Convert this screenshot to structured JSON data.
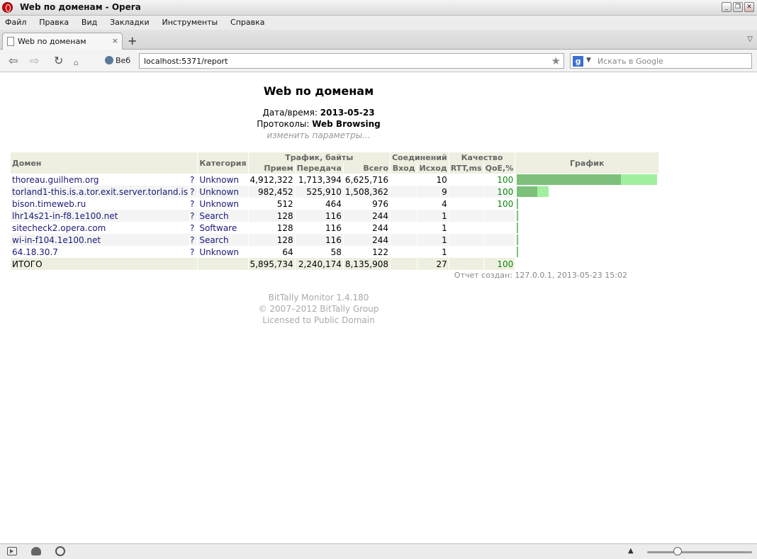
{
  "window": {
    "title": "Web по доменам - Opera"
  },
  "menu": [
    "Файл",
    "Правка",
    "Вид",
    "Закладки",
    "Инструменты",
    "Справка"
  ],
  "tab": {
    "title": "Web по доменам",
    "close": "×"
  },
  "nav": {
    "web_label": "Веб",
    "url": "localhost:5371/report",
    "search_placeholder": "Искать в Google"
  },
  "report": {
    "title": "Web по доменам",
    "datetime_label": "Дата/время:",
    "datetime_value": "2013-05-23",
    "protocols_label": "Протоколы:",
    "protocols_value": "Web Browsing",
    "change_link": "изменить параметры...",
    "headers": {
      "domain": "Домен",
      "category": "Категория",
      "traffic": "Трафик, байты",
      "connections": "Соединений",
      "quality": "Качество",
      "graph": "График",
      "recv": "Прием",
      "send": "Передача",
      "total": "Всего",
      "inbound": "Вход",
      "outbound": "Исход",
      "rtt": "RTT,ms",
      "qoe": "QoE,%"
    },
    "rows": [
      {
        "domain": "thoreau.guilhem.org",
        "q": "?",
        "category": "Unknown",
        "recv": "4,912,322",
        "send": "1,713,394",
        "total": "6,625,716",
        "in": "",
        "out": "10",
        "rtt": "",
        "qoe": "100",
        "bar_recv": 0.74,
        "bar_total": 1.0
      },
      {
        "domain": "torland1-this.is.a.tor.exit.server.torland.is",
        "q": "?",
        "category": "Unknown",
        "recv": "982,452",
        "send": "525,910",
        "total": "1,508,362",
        "in": "",
        "out": "9",
        "rtt": "",
        "qoe": "100",
        "bar_recv": 0.148,
        "bar_total": 0.228
      },
      {
        "domain": "bison.timeweb.ru",
        "q": "?",
        "category": "Unknown",
        "recv": "512",
        "send": "464",
        "total": "976",
        "in": "",
        "out": "4",
        "rtt": "",
        "qoe": "100",
        "bar_recv": 0.01,
        "bar_total": 0.01
      },
      {
        "domain": "lhr14s21-in-f8.1e100.net",
        "q": "?",
        "category": "Search",
        "recv": "128",
        "send": "116",
        "total": "244",
        "in": "",
        "out": "1",
        "rtt": "",
        "qoe": "",
        "bar_recv": 0.01,
        "bar_total": 0.01
      },
      {
        "domain": "sitecheck2.opera.com",
        "q": "?",
        "category": "Software",
        "recv": "128",
        "send": "116",
        "total": "244",
        "in": "",
        "out": "1",
        "rtt": "",
        "qoe": "",
        "bar_recv": 0.01,
        "bar_total": 0.01
      },
      {
        "domain": "wi-in-f104.1e100.net",
        "q": "?",
        "category": "Search",
        "recv": "128",
        "send": "116",
        "total": "244",
        "in": "",
        "out": "1",
        "rtt": "",
        "qoe": "",
        "bar_recv": 0.01,
        "bar_total": 0.01
      },
      {
        "domain": "64.18.30.7",
        "q": "?",
        "category": "Unknown",
        "recv": "64",
        "send": "58",
        "total": "122",
        "in": "",
        "out": "1",
        "rtt": "",
        "qoe": "",
        "bar_recv": 0.01,
        "bar_total": 0.01
      }
    ],
    "totals": {
      "label": "ИТОГО",
      "recv": "5,895,734",
      "send": "2,240,174",
      "total": "8,135,908",
      "out": "27",
      "qoe": "100"
    },
    "created": "Отчет создан: 127.0.0.1, 2013-05-23 15:02",
    "footer": [
      "BitTally Monitor 1.4.180",
      "© 2007–2012 BitTally Group",
      "Licensed to Public Domain"
    ]
  },
  "colors": {
    "bar_recv": "#7cc07c",
    "bar_total": "#a0f0a0",
    "qoe": "#0a8a0a",
    "header_bg": "#efefe1"
  }
}
